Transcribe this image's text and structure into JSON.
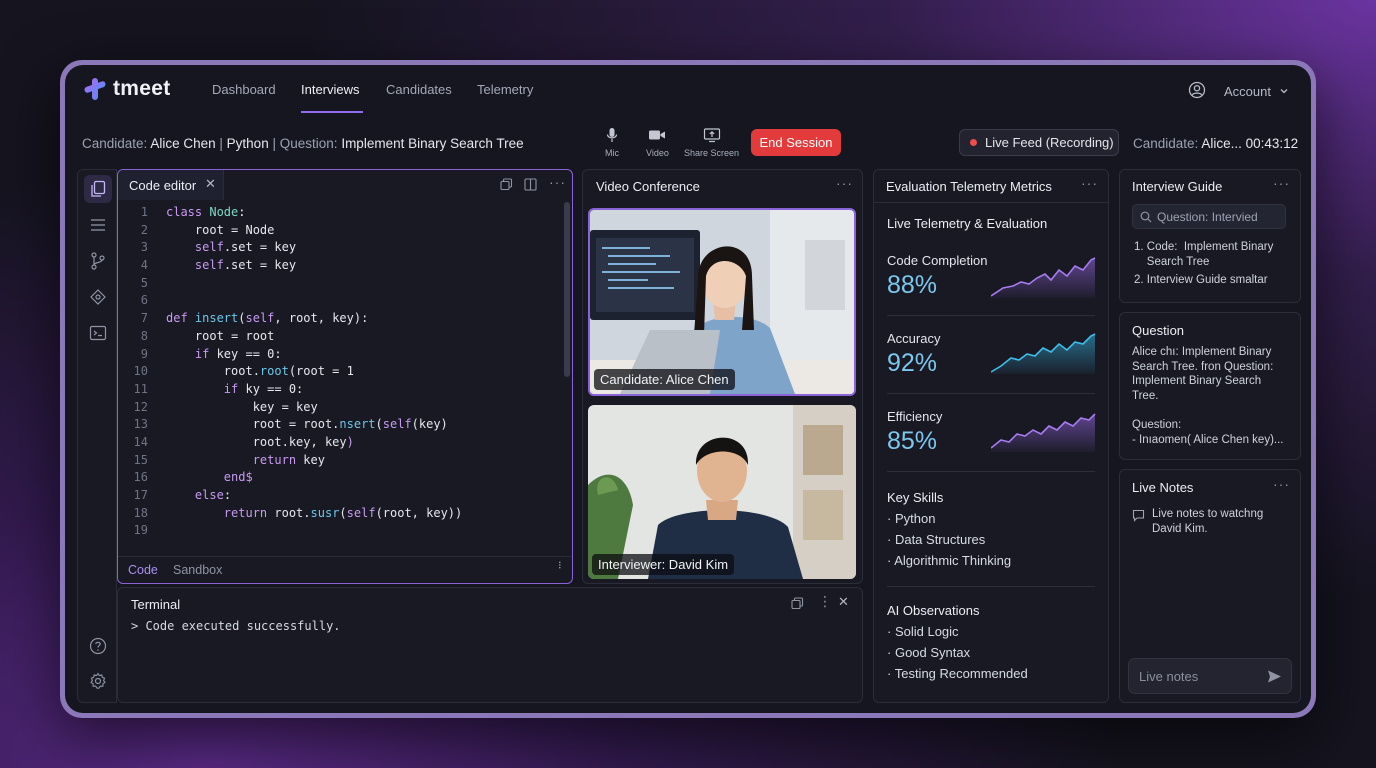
{
  "app": {
    "name": "tmeet"
  },
  "nav": {
    "items": [
      "Dashboard",
      "Interviews",
      "Candidates",
      "Telemetry"
    ],
    "active": "Interviews",
    "account_label": "Account"
  },
  "session": {
    "candidate_prefix": "Candidate:",
    "candidate_name": "Alice Chen",
    "sep": "|",
    "language": "Python",
    "question_prefix": "Question:",
    "question": "Implement Binary Search Tree",
    "controls": {
      "mic": "Mic",
      "video": "Video",
      "share": "Share Screen"
    },
    "end_label": "End Session",
    "live_label": "Live Feed (Recording)",
    "right_prefix": "Candidate:",
    "right_name": "Alice...",
    "timer": "00:43:12",
    "accent_color": "#e33b3b"
  },
  "editor": {
    "tab_label": "Code editor",
    "lines": [
      {
        "n": "1",
        "parts": [
          [
            "kw",
            "class "
          ],
          [
            "cls",
            "Node"
          ],
          [
            "t",
            ":"
          ]
        ]
      },
      {
        "n": "2",
        "parts": [
          [
            "t",
            "    root = Node"
          ]
        ]
      },
      {
        "n": "3",
        "parts": [
          [
            "t",
            "    "
          ],
          [
            "kw",
            "self"
          ],
          [
            "t",
            ".set = key"
          ]
        ]
      },
      {
        "n": "4",
        "parts": [
          [
            "t",
            "    "
          ],
          [
            "kw",
            "self"
          ],
          [
            "t",
            ".set = key"
          ]
        ]
      },
      {
        "n": "5",
        "parts": []
      },
      {
        "n": "6",
        "parts": []
      },
      {
        "n": "7",
        "parts": [
          [
            "kw",
            "def "
          ],
          [
            "fn",
            "insert"
          ],
          [
            "t",
            "("
          ],
          [
            "kw",
            "self"
          ],
          [
            "t",
            ", root, key):"
          ]
        ]
      },
      {
        "n": "8",
        "parts": [
          [
            "t",
            "    root = root"
          ]
        ]
      },
      {
        "n": "9",
        "parts": [
          [
            "t",
            "    "
          ],
          [
            "kw",
            "if"
          ],
          [
            "t",
            " key == 0:"
          ]
        ]
      },
      {
        "n": "10",
        "parts": [
          [
            "t",
            "        root."
          ],
          [
            "fn",
            "root"
          ],
          [
            "t",
            "(root = 1"
          ]
        ]
      },
      {
        "n": "11",
        "parts": [
          [
            "t",
            "        "
          ],
          [
            "kw",
            "if"
          ],
          [
            "t",
            " ky == 0:"
          ]
        ]
      },
      {
        "n": "12",
        "parts": [
          [
            "t",
            "            key = key"
          ]
        ]
      },
      {
        "n": "13",
        "parts": [
          [
            "t",
            "            root = root."
          ],
          [
            "fn",
            "nsert"
          ],
          [
            "t",
            "("
          ],
          [
            "kw",
            "self"
          ],
          [
            "t",
            "(key)"
          ]
        ]
      },
      {
        "n": "14",
        "parts": [
          [
            "t",
            "            root.key, key"
          ],
          [
            "kw",
            ")"
          ]
        ]
      },
      {
        "n": "15",
        "parts": [
          [
            "t",
            "            "
          ],
          [
            "kw",
            "return"
          ],
          [
            "t",
            " key"
          ]
        ]
      },
      {
        "n": "16",
        "parts": [
          [
            "t",
            "        "
          ],
          [
            "kw",
            "end$"
          ]
        ]
      },
      {
        "n": "17",
        "parts": [
          [
            "t",
            "    "
          ],
          [
            "kw",
            "else"
          ],
          [
            "t",
            ":"
          ]
        ]
      },
      {
        "n": "18",
        "parts": [
          [
            "t",
            "        "
          ],
          [
            "kw",
            "return"
          ],
          [
            "t",
            " root."
          ],
          [
            "fn",
            "susr"
          ],
          [
            "t",
            "("
          ],
          [
            "kw",
            "self"
          ],
          [
            "t",
            "(root, key))"
          ]
        ]
      },
      {
        "n": "19",
        "parts": []
      }
    ],
    "footer_tabs": [
      "Code",
      "Sandbox"
    ]
  },
  "terminal": {
    "title": "Terminal",
    "output": "> Code executed successfully."
  },
  "video": {
    "title": "Video Conference",
    "candidate_label": "Candidate: Alice Chen",
    "interviewer_label": "Interviewer: David Kim"
  },
  "metrics": {
    "title": "Evaluation Telemetry Metrics",
    "subtitle": "Live Telemetry & Evaluation",
    "items": [
      {
        "label": "Code Completion",
        "value": "88%",
        "color": "#9b6ae8"
      },
      {
        "label": "Accuracy",
        "value": "92%",
        "color": "#36b3e0"
      },
      {
        "label": "Efficiency",
        "value": "85%",
        "color": "#9b6ae8"
      }
    ],
    "skills_title": "Key Skills",
    "skills": [
      "Python",
      "Data Structures",
      "Algorithmic Thinking"
    ],
    "obs_title": "AI Observations",
    "observations": [
      "Solid Logic",
      "Good Syntax",
      "Testing Recommended"
    ]
  },
  "guide": {
    "title": "Interview Guide",
    "search_placeholder": "Question: Intervied",
    "items": [
      "1. Code:  Implement Binary\n    Search Tree",
      "2. Interview Guide smaltar"
    ]
  },
  "question": {
    "title": "Question",
    "text1": "Alice chı: Implement Binary\nSearch Tree. fron Question:\nImplement Binary Search\nTree.",
    "text2": "Question:\n- Inıaomen( Alice Chen key)..."
  },
  "notes": {
    "title": "Live Notes",
    "entry": "Live notes to watchng\nDavid Kim.",
    "input_placeholder": "Live notes"
  }
}
